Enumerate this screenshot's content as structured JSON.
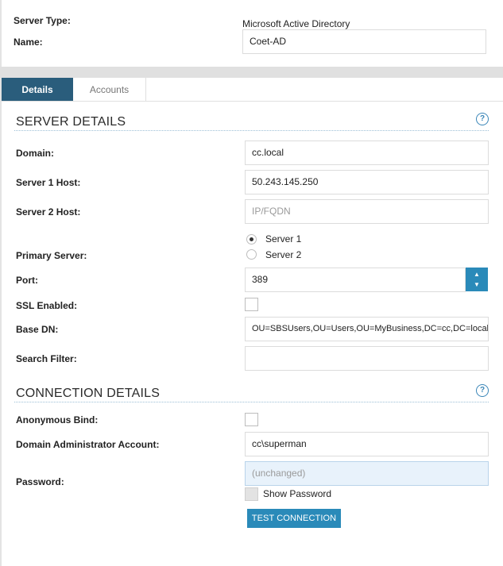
{
  "header": {
    "server_type_label": "Server Type:",
    "server_type_value": "Microsoft Active Directory",
    "name_label": "Name:",
    "name_value": "Coet-AD"
  },
  "tabs": [
    {
      "label": "Details",
      "active": true
    },
    {
      "label": "Accounts",
      "active": false
    }
  ],
  "server_details": {
    "title": "SERVER DETAILS",
    "help_icon": "?",
    "domain_label": "Domain:",
    "domain_value": "cc.local",
    "server1_label": "Server 1 Host:",
    "server1_value": "50.243.145.250",
    "server2_label": "Server 2 Host:",
    "server2_placeholder": "IP/FQDN",
    "primary_label": "Primary Server:",
    "primary_options": [
      "Server 1",
      "Server 2"
    ],
    "primary_selected": "Server 1",
    "port_label": "Port:",
    "port_value": "389",
    "ssl_label": "SSL Enabled:",
    "ssl_checked": false,
    "basedn_label": "Base DN:",
    "basedn_value": "OU=SBSUsers,OU=Users,OU=MyBusiness,DC=cc,DC=local",
    "filter_label": "Search Filter:",
    "filter_value": ""
  },
  "connection_details": {
    "title": "CONNECTION DETAILS",
    "help_icon": "?",
    "anon_label": "Anonymous Bind:",
    "anon_checked": false,
    "admin_label": "Domain Administrator Account:",
    "admin_value": "cc\\superman",
    "password_label": "Password:",
    "password_placeholder": "(unchanged)",
    "show_password_label": "Show Password",
    "show_password_checked": false,
    "test_button": "TEST CONNECTION"
  },
  "colors": {
    "tab_active_bg": "#2a5d7c",
    "accent": "#2a8ab9",
    "password_bg": "#e8f2fb"
  }
}
